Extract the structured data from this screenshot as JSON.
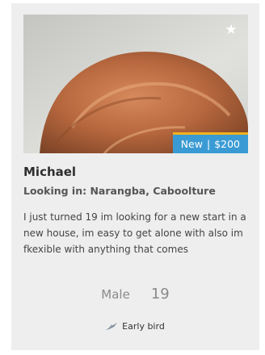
{
  "listing": {
    "favorite_icon": "star-icon",
    "tag": {
      "status": "New",
      "separator": "|",
      "price": "$200"
    },
    "name": "Michael",
    "location_label": "Looking in: Narangba, Caboolture",
    "description": "I just turned 19 im looking for a new start in a new house, im easy to get alone with also im fkexible with anything that comes",
    "gender": "Male",
    "age": "19",
    "badge": {
      "icon": "bird-icon",
      "label": "Early bird"
    }
  },
  "colors": {
    "card_background": "#eeeeee",
    "tag_background": "#3a9bd4",
    "tag_accent": "#f3b21b"
  }
}
